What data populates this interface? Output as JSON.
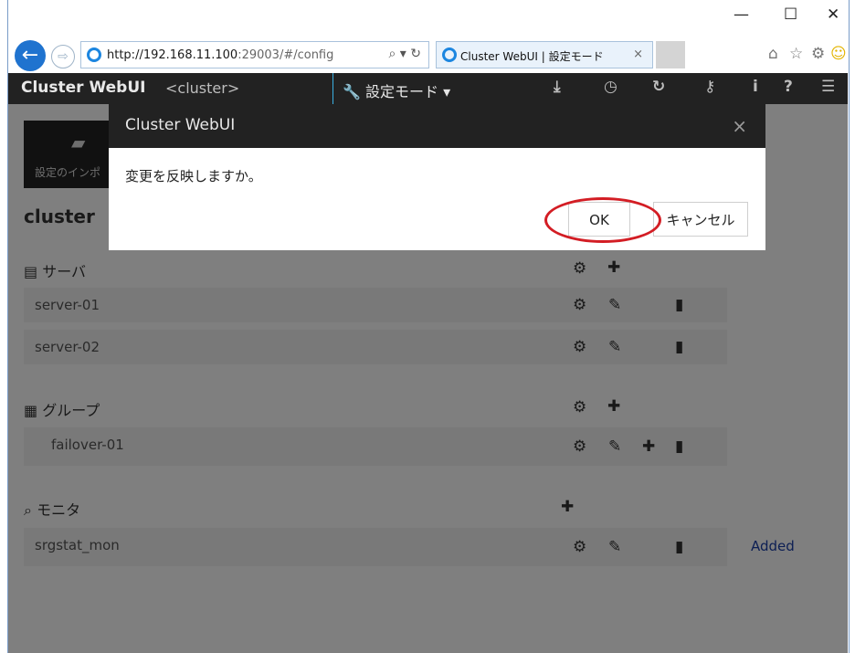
{
  "browser": {
    "url_host": "http://192.168.11.100",
    "url_rest": ":29003/#/config",
    "tab_title": "Cluster WebUI | 設定モード",
    "tab_close": "×",
    "controls": {
      "minimize": "—",
      "maximize": "☐",
      "close": "✕"
    }
  },
  "navbar": {
    "brand": "Cluster WebUI",
    "cluster": "<cluster>",
    "mode": "🔧 設定モード ▾"
  },
  "content": {
    "import_label": "設定のインポ",
    "cluster_title": "cluster",
    "servers_title": "サーバ",
    "servers": [
      "server-01",
      "server-02"
    ],
    "groups_title": "グループ",
    "groups": [
      "failover-01"
    ],
    "monitors_title": "モニタ",
    "monitors": [
      {
        "name": "srgstat_mon",
        "status": "Added"
      }
    ]
  },
  "modal": {
    "title": "Cluster WebUI",
    "close": "×",
    "message": "変更を反映しますか。",
    "ok_label": "OK",
    "cancel_label": "キャンセル"
  },
  "colors": {
    "annotation": "#d31d24",
    "navbar": "#222222",
    "added": "#1a3fa8"
  }
}
